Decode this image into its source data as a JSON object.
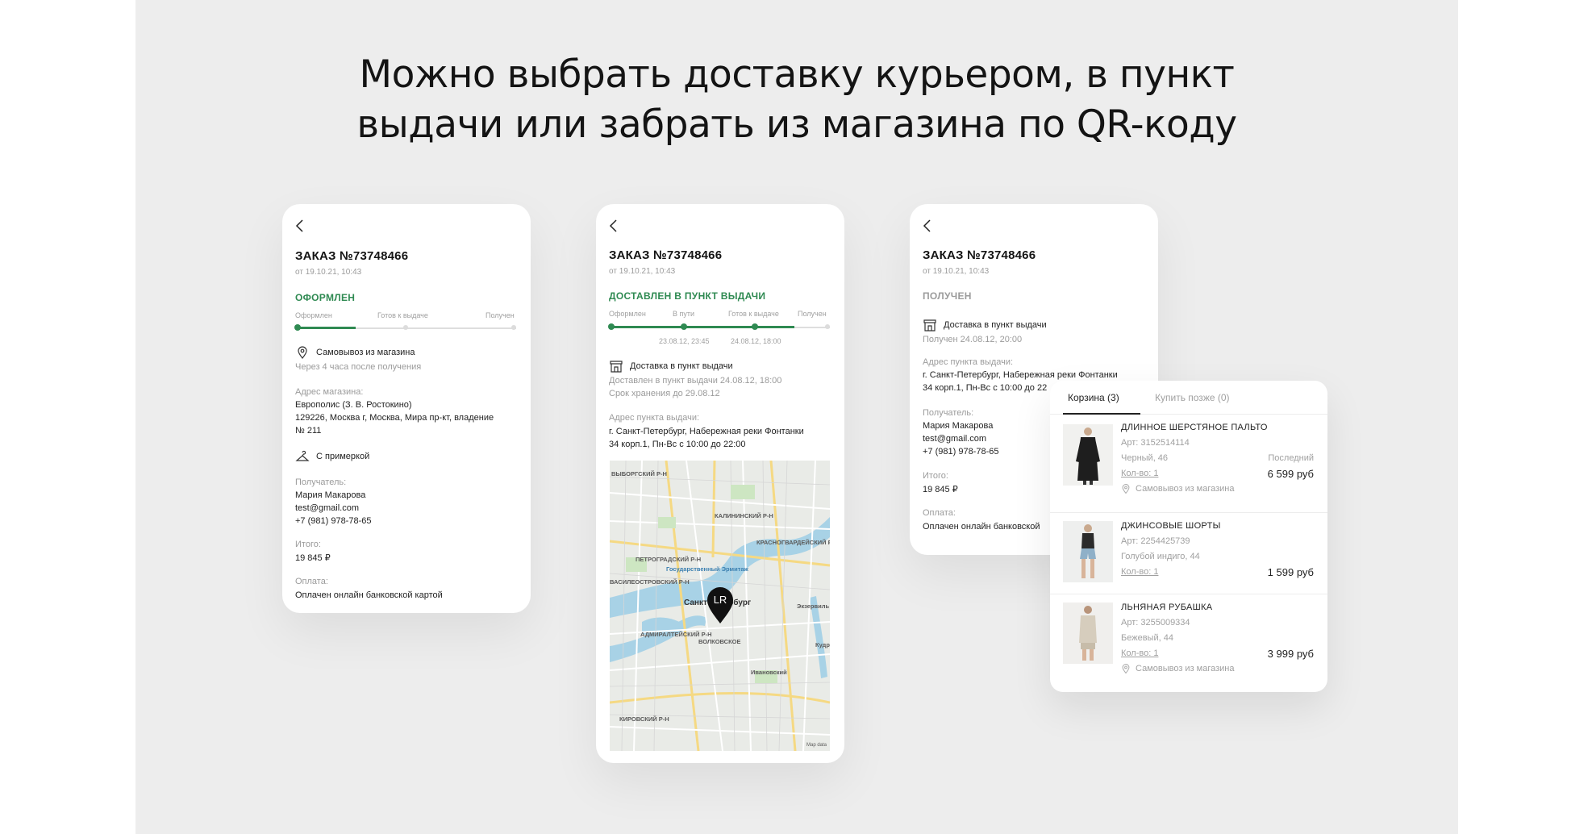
{
  "headline": {
    "line1": "Можно выбрать доставку курьером, в пункт",
    "line2": "выдачи или забрать из магазина по QR-коду"
  },
  "colors": {
    "accent_green": "#2f8a52",
    "background": "#ededed",
    "card": "#ffffff"
  },
  "card1": {
    "title": "ЗАКАЗ №73748466",
    "date": "от 19.10.21, 10:43",
    "status": "ОФОРМЛЕН",
    "steps": [
      "Оформлен",
      "Готов к выдаче",
      "Получен"
    ],
    "progress": 0.27,
    "delivery": "Самовывоз из магазина",
    "delivery_note": "Через 4 часа после получения",
    "address_label": "Адрес магазина:",
    "address_line1": "Европолис (З. В. Ростокино)",
    "address_line2": "129226, Москва г, Москва, Мира пр-кт, владение",
    "address_line3": "№ 211",
    "fitting": "С примеркой",
    "recipient_label": "Получатель:",
    "recipient_name": "Мария Макарова",
    "recipient_email": "test@gmail.com",
    "recipient_phone": "+7 (981) 978-78-65",
    "total_label": "Итого:",
    "total": "19 845 ₽",
    "payment_label": "Оплата:",
    "payment": "Оплачен онлайн банковской картой"
  },
  "card2": {
    "title": "ЗАКАЗ №73748466",
    "date": "от 19.10.21, 10:43",
    "status": "ДОСТАВЛЕН В ПУНКТ ВЫДАЧИ",
    "steps": [
      "Оформлен",
      "В пути",
      "Готов к выдаче",
      "Получен"
    ],
    "step_dates": [
      "23.08.12, 23:45",
      "24.08.12, 18:00"
    ],
    "delivery": "Доставка в пункт выдачи",
    "delivered_note": "Доставлен в пункт выдачи 24.08.12, 18:00",
    "storage_note": "Срок хранения до 29.08.12",
    "address_label": "Адрес пункта выдачи:",
    "address_line1": "г. Санкт-Петербург, Набережная реки Фонтанки",
    "address_line2": "34 корп.1, Пн-Вс с 10:00 до 22:00",
    "map": {
      "pin_label": "LR",
      "labels": [
        "ВЫБОРГСКИЙ Р-Н",
        "КАЛИНИНСКИЙ Р-Н",
        "КРАСНОГВАРДЕЙСКИЙ Р",
        "ПЕТРОГРАДСКИЙ Р-Н",
        "Государственный Эрмитаж",
        "ВАСИЛЕОСТРОВСКИЙ Р-Н",
        "Санкт-Петербург",
        "АДМИРАЛТЕЙСКИЙ Р-Н",
        "ВОЛКОВСКОЕ",
        "Экзервиль",
        "Кудр",
        "Ивановский",
        "КИРОВСКИЙ Р-Н",
        "Map data"
      ]
    }
  },
  "card3": {
    "title": "ЗАКАЗ №73748466",
    "date": "от 19.10.21, 10:43",
    "status": "ПОЛУЧЕН",
    "delivery": "Доставка в пункт выдачи",
    "received_note": "Получен 24.08.12, 20:00",
    "address_label": "Адрес пункта выдачи:",
    "address_line1": "г. Санкт-Петербург, Набережная реки Фонтанки",
    "address_line2": "34 корп.1, Пн-Вс с 10:00 до 22",
    "recipient_label": "Получатель:",
    "recipient_name": "Мария Макарова",
    "recipient_email": "test@gmail.com",
    "recipient_phone": "+7 (981) 978-78-65",
    "total_label": "Итого:",
    "total": "19 845 ₽",
    "payment_label": "Оплата:",
    "payment": "Оплачен онлайн банковской"
  },
  "cart": {
    "tab_active": "Корзина (3)",
    "tab_inactive": "Купить позже (0)",
    "items": [
      {
        "name": "ДЛИННОЕ ШЕРСТЯНОЕ ПАЛЬТО",
        "art": "Арт: 3152514114",
        "color": "Черный, 46",
        "badge": "Последний",
        "qty": "Кол-во: 1",
        "price": "6 599 руб",
        "pickup": "Самовывоз из магазина"
      },
      {
        "name": "ДЖИНСОВЫЕ ШОРТЫ",
        "art": "Арт: 2254425739",
        "color": "Голубой индиго, 44",
        "badge": "",
        "qty": "Кол-во: 1",
        "price": "1 599 руб",
        "pickup": ""
      },
      {
        "name": "ЛЬНЯНАЯ РУБАШКА",
        "art": "Арт: 3255009334",
        "color": "Бежевый, 44",
        "badge": "",
        "qty": "Кол-во: 1",
        "price": "3 999 руб",
        "pickup": "Самовывоз из магазина"
      }
    ]
  }
}
